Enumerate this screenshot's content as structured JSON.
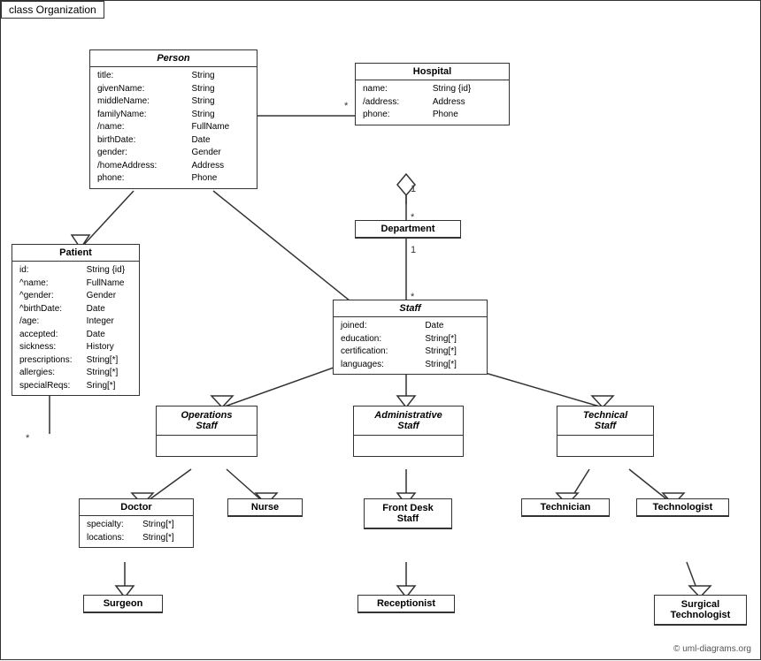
{
  "frame": {
    "label": "class Organization"
  },
  "copyright": "© uml-diagrams.org",
  "classes": {
    "person": {
      "title": "Person",
      "italic": true,
      "attrs": [
        [
          "title:",
          "String"
        ],
        [
          "givenName:",
          "String"
        ],
        [
          "middleName:",
          "String"
        ],
        [
          "familyName:",
          "String"
        ],
        [
          "/name:",
          "FullName"
        ],
        [
          "birthDate:",
          "Date"
        ],
        [
          "gender:",
          "Gender"
        ],
        [
          "/homeAddress:",
          "Address"
        ],
        [
          "phone:",
          "Phone"
        ]
      ]
    },
    "hospital": {
      "title": "Hospital",
      "italic": false,
      "attrs": [
        [
          "name:",
          "String {id}"
        ],
        [
          "/address:",
          "Address"
        ],
        [
          "phone:",
          "Phone"
        ]
      ]
    },
    "patient": {
      "title": "Patient",
      "italic": false,
      "attrs": [
        [
          "id:",
          "String {id}"
        ],
        [
          "^name:",
          "FullName"
        ],
        [
          "^gender:",
          "Gender"
        ],
        [
          "^birthDate:",
          "Date"
        ],
        [
          "/age:",
          "Integer"
        ],
        [
          "accepted:",
          "Date"
        ],
        [
          "sickness:",
          "History"
        ],
        [
          "prescriptions:",
          "String[*]"
        ],
        [
          "allergies:",
          "String[*]"
        ],
        [
          "specialReqs:",
          "Sring[*]"
        ]
      ]
    },
    "department": {
      "title": "Department",
      "italic": false,
      "attrs": []
    },
    "staff": {
      "title": "Staff",
      "italic": true,
      "attrs": [
        [
          "joined:",
          "Date"
        ],
        [
          "education:",
          "String[*]"
        ],
        [
          "certification:",
          "String[*]"
        ],
        [
          "languages:",
          "String[*]"
        ]
      ]
    },
    "operations_staff": {
      "title": "Operations\nStaff",
      "italic": true,
      "attrs": []
    },
    "administrative_staff": {
      "title": "Administrative\nStaff",
      "italic": true,
      "attrs": []
    },
    "technical_staff": {
      "title": "Technical\nStaff",
      "italic": true,
      "attrs": []
    },
    "doctor": {
      "title": "Doctor",
      "italic": false,
      "attrs": [
        [
          "specialty:",
          "String[*]"
        ],
        [
          "locations:",
          "String[*]"
        ]
      ]
    },
    "nurse": {
      "title": "Nurse",
      "italic": false,
      "attrs": []
    },
    "front_desk": {
      "title": "Front Desk\nStaff",
      "italic": false,
      "attrs": []
    },
    "technician": {
      "title": "Technician",
      "italic": false,
      "attrs": []
    },
    "technologist": {
      "title": "Technologist",
      "italic": false,
      "attrs": []
    },
    "surgeon": {
      "title": "Surgeon",
      "italic": false,
      "attrs": []
    },
    "receptionist": {
      "title": "Receptionist",
      "italic": false,
      "attrs": []
    },
    "surgical_technologist": {
      "title": "Surgical\nTechnologist",
      "italic": false,
      "attrs": []
    }
  }
}
